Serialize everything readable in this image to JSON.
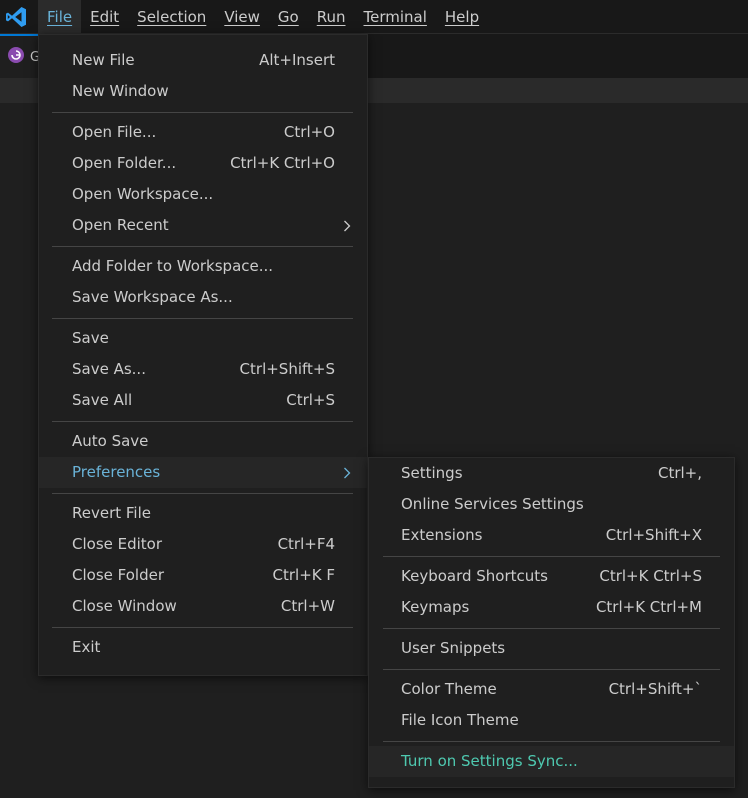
{
  "colors": {
    "accent": "#0078d4",
    "menu_highlight_text": "#6ab3d8",
    "sync_text": "#4ec9b0",
    "background": "#1f1f1f"
  },
  "app": {
    "logo_icon": "vscode-logo-icon"
  },
  "menubar": {
    "items": [
      {
        "label": "File",
        "active": true
      },
      {
        "label": "Edit"
      },
      {
        "label": "Selection"
      },
      {
        "label": "View"
      },
      {
        "label": "Go"
      },
      {
        "label": "Run"
      },
      {
        "label": "Terminal"
      },
      {
        "label": "Help"
      }
    ]
  },
  "tab": {
    "label": "G",
    "icon": "gatsby-icon"
  },
  "file_menu": {
    "new_file": {
      "label": "New File",
      "shortcut": "Alt+Insert"
    },
    "new_window": {
      "label": "New Window"
    },
    "open_file": {
      "label": "Open File...",
      "shortcut": "Ctrl+O"
    },
    "open_folder": {
      "label": "Open Folder...",
      "shortcut": "Ctrl+K Ctrl+O"
    },
    "open_workspace": {
      "label": "Open Workspace..."
    },
    "open_recent": {
      "label": "Open Recent"
    },
    "add_folder": {
      "label": "Add Folder to Workspace..."
    },
    "save_workspace_as": {
      "label": "Save Workspace As..."
    },
    "save": {
      "label": "Save"
    },
    "save_as": {
      "label": "Save As...",
      "shortcut": "Ctrl+Shift+S"
    },
    "save_all": {
      "label": "Save All",
      "shortcut": "Ctrl+S"
    },
    "auto_save": {
      "label": "Auto Save"
    },
    "preferences": {
      "label": "Preferences"
    },
    "revert_file": {
      "label": "Revert File"
    },
    "close_editor": {
      "label": "Close Editor",
      "shortcut": "Ctrl+F4"
    },
    "close_folder": {
      "label": "Close Folder",
      "shortcut": "Ctrl+K F"
    },
    "close_window": {
      "label": "Close Window",
      "shortcut": "Ctrl+W"
    },
    "exit": {
      "label": "Exit"
    }
  },
  "pref_menu": {
    "settings": {
      "label": "Settings",
      "shortcut": "Ctrl+,"
    },
    "online_services": {
      "label": "Online Services Settings"
    },
    "extensions": {
      "label": "Extensions",
      "shortcut": "Ctrl+Shift+X"
    },
    "keyboard_shortcuts": {
      "label": "Keyboard Shortcuts",
      "shortcut": "Ctrl+K Ctrl+S"
    },
    "keymaps": {
      "label": "Keymaps",
      "shortcut": "Ctrl+K Ctrl+M"
    },
    "user_snippets": {
      "label": "User Snippets"
    },
    "color_theme": {
      "label": "Color Theme",
      "shortcut": "Ctrl+Shift+`"
    },
    "file_icon_theme": {
      "label": "File Icon Theme"
    },
    "settings_sync": {
      "label": "Turn on Settings Sync..."
    }
  }
}
